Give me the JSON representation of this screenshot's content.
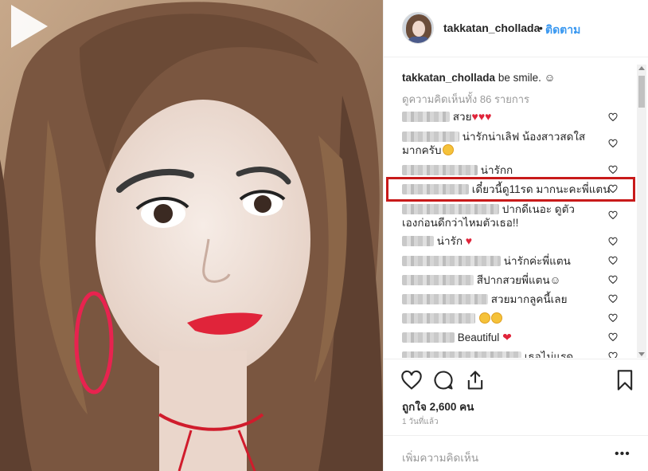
{
  "post": {
    "username": "takkatan_chollada",
    "follow_dot": "•",
    "follow_label": "ติดตาม",
    "caption_user": "takkatan_chollada",
    "caption_text": "be smile. ☺",
    "view_all": "ดูความคิดเห็นทั้ง 86 รายการ",
    "likes": "ถูกใจ 2,600 คน",
    "time": "1 วันที่แล้ว",
    "add_comment_placeholder": "เพิ่มความคิดเห็น",
    "more": "•••"
  },
  "comments": [
    {
      "text": "สวย",
      "emoji": "♥♥♥",
      "line2": ""
    },
    {
      "text": "น่ารักน่าเลิฟ น้องสาวสดใส",
      "emoji": "",
      "line2": "มากครับ"
    },
    {
      "text": "น่ารักก",
      "emoji": "",
      "line2": ""
    },
    {
      "text": "เดี๋ยวนี้ดู11รด มากนะคะพี่แตน",
      "emoji": "",
      "line2": ""
    },
    {
      "text": "ปากดีเนอะ ดูตัว",
      "emoji": "",
      "line2": "เองก่อนดีกว่าไหมตัวเธอ!!"
    },
    {
      "text": "น่ารัก",
      "emoji": "♥",
      "line2": ""
    },
    {
      "text": "น่ารักค่ะพี่แตน",
      "emoji": "",
      "line2": ""
    },
    {
      "text": "สีปากสวยพี่แตน☺",
      "emoji": "",
      "line2": ""
    },
    {
      "text": "สวยมากลูคนี้เลย",
      "emoji": "",
      "line2": ""
    },
    {
      "text": "",
      "emoji": "",
      "line2": ""
    },
    {
      "text": "Beautiful",
      "emoji": "❤",
      "line2": ""
    },
    {
      "text": "เธอไม่แรด",
      "emoji": "",
      "line2": ""
    }
  ],
  "colors": {
    "accent": "#3897f0",
    "highlight": "#c81a1a",
    "heart": "#e0243a"
  },
  "icons": [
    "play-icon",
    "heart-icon",
    "comment-icon",
    "share-icon",
    "bookmark-icon",
    "heart-small-icon"
  ]
}
